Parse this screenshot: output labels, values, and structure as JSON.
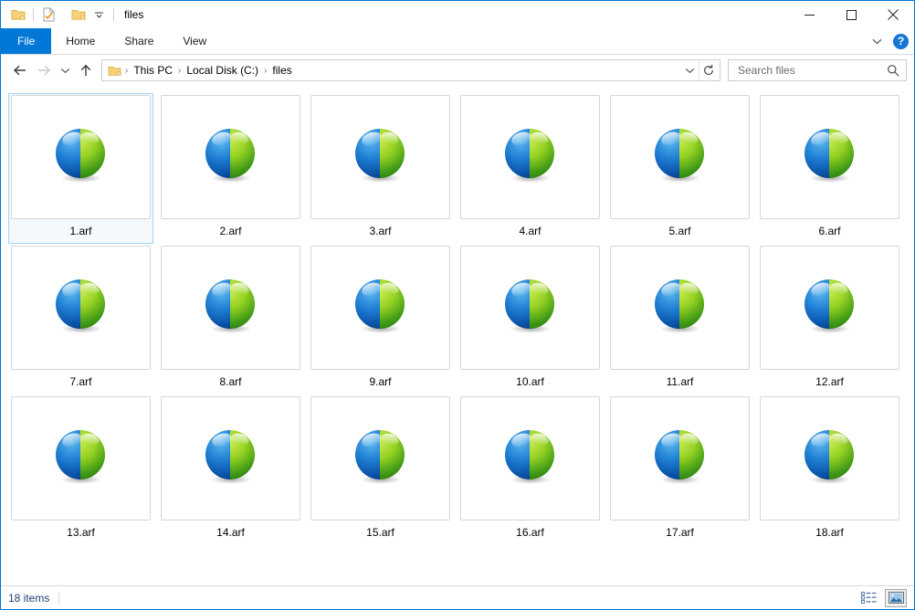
{
  "window": {
    "title": "files",
    "quick_access": [
      {
        "name": "folder-icon",
        "label": "New folder"
      },
      {
        "name": "properties-icon",
        "label": "Properties"
      },
      {
        "name": "folder-icon-2",
        "label": "Open folder"
      },
      {
        "name": "chevron-down-icon",
        "label": "Customize Quick Access Toolbar"
      }
    ],
    "controls": {
      "minimize": "—",
      "maximize": "☐",
      "close": "✕"
    },
    "border_color": "#0078d7"
  },
  "ribbon": {
    "tabs": [
      {
        "label": "File",
        "active_file": true
      },
      {
        "label": "Home",
        "active_file": false
      },
      {
        "label": "Share",
        "active_file": false
      },
      {
        "label": "View",
        "active_file": false
      }
    ],
    "expand_icon": "chevron-down-icon",
    "help_label": "?",
    "accent_color": "#0078d7"
  },
  "address": {
    "back_label": "Back",
    "forward_label": "Forward",
    "recent_label": "Recent locations",
    "up_label": "Up one level",
    "breadcrumb": [
      "This PC",
      "Local Disk (C:)",
      "files"
    ],
    "separator": "›",
    "refresh_label": "Refresh"
  },
  "search": {
    "placeholder": "Search files",
    "value": "",
    "icon": "search-icon"
  },
  "files": {
    "items": [
      {
        "name": "1.arf",
        "selected": true
      },
      {
        "name": "2.arf",
        "selected": false
      },
      {
        "name": "3.arf",
        "selected": false
      },
      {
        "name": "4.arf",
        "selected": false
      },
      {
        "name": "5.arf",
        "selected": false
      },
      {
        "name": "6.arf",
        "selected": false
      },
      {
        "name": "7.arf",
        "selected": false
      },
      {
        "name": "8.arf",
        "selected": false
      },
      {
        "name": "9.arf",
        "selected": false
      },
      {
        "name": "10.arf",
        "selected": false
      },
      {
        "name": "11.arf",
        "selected": false
      },
      {
        "name": "12.arf",
        "selected": false
      },
      {
        "name": "13.arf",
        "selected": false
      },
      {
        "name": "14.arf",
        "selected": false
      },
      {
        "name": "15.arf",
        "selected": false
      },
      {
        "name": "16.arf",
        "selected": false
      },
      {
        "name": "17.arf",
        "selected": false
      },
      {
        "name": "18.arf",
        "selected": false
      }
    ],
    "icon_name": "sphere-file-icon",
    "icon_colors": {
      "blue_light": "#3aa3e8",
      "blue_dark": "#0b4ea2",
      "green_light": "#b6e23a",
      "green_dark": "#2f8f16"
    },
    "selection_color": "#a3d3f5"
  },
  "status": {
    "item_count": "18 items",
    "views": [
      {
        "name": "details-view-button",
        "active": false
      },
      {
        "name": "large-icons-view-button",
        "active": true
      }
    ]
  }
}
